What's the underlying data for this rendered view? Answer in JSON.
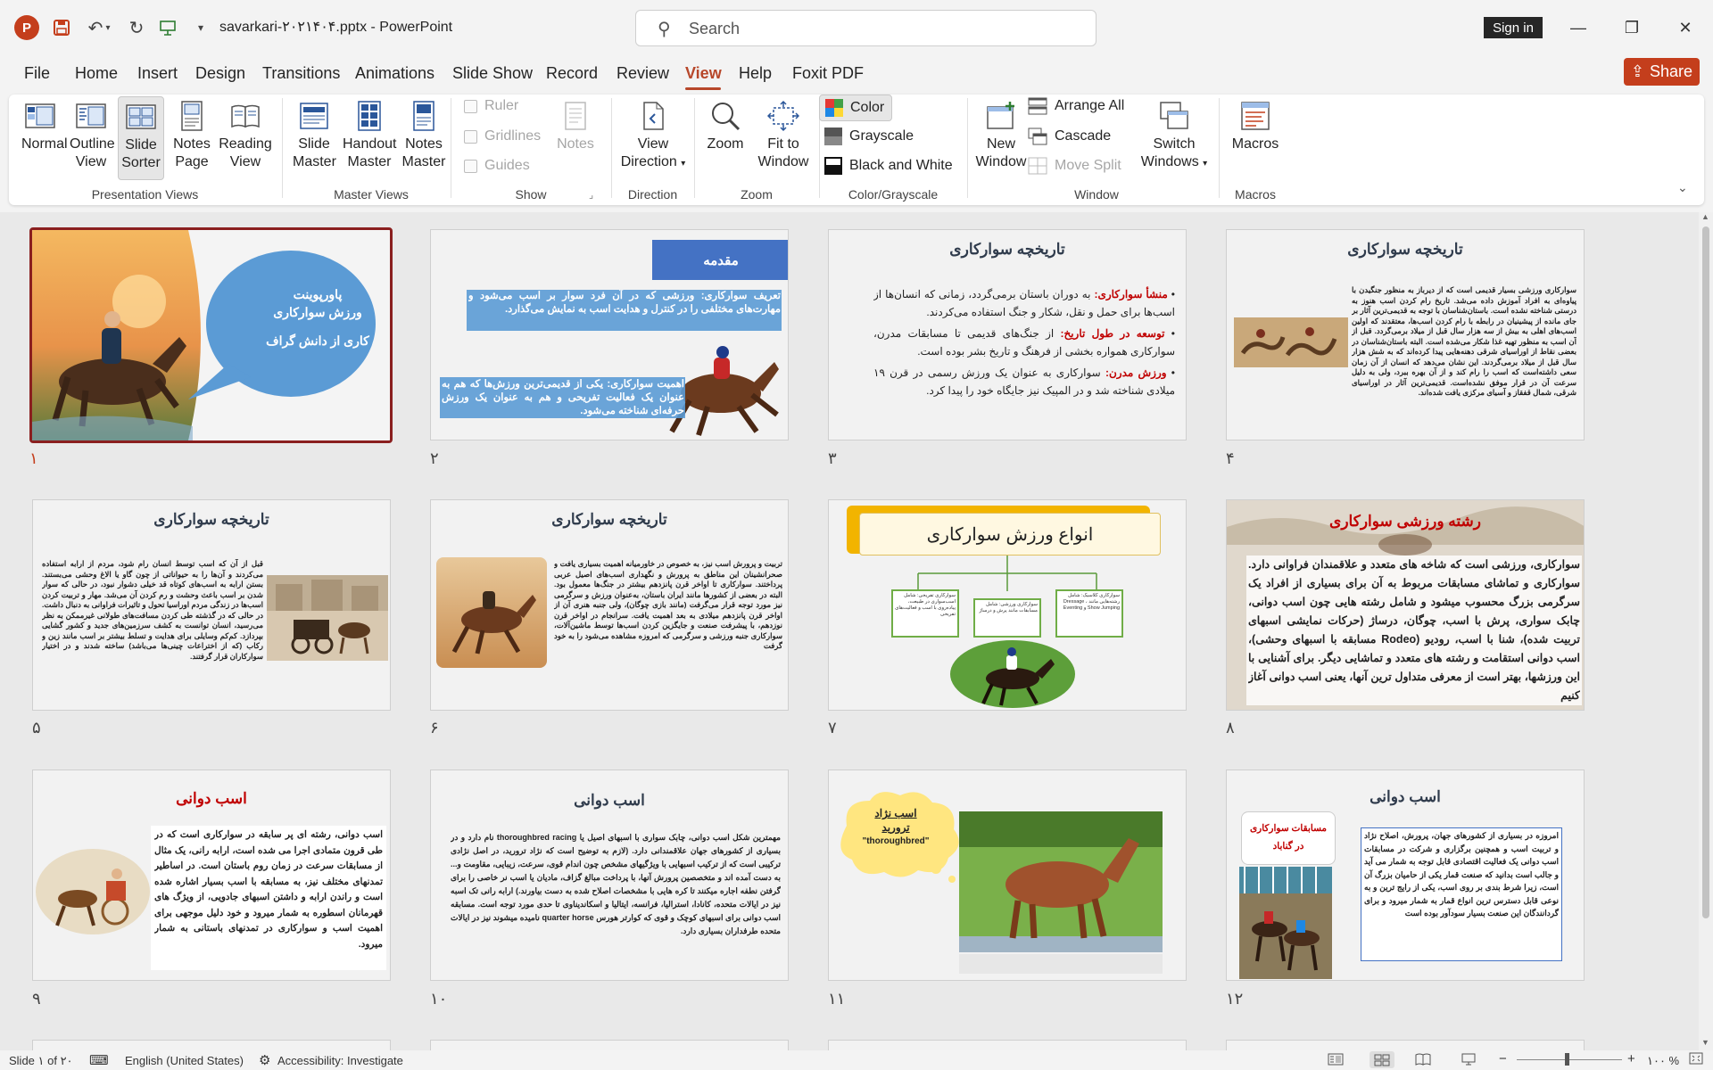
{
  "app": {
    "file_name": "savarkari-۲۰۲۱۴۰۴.pptx",
    "app_name": "PowerPoint",
    "title_sep": " - ",
    "search_placeholder": "Search",
    "sign_in": "Sign in",
    "share": "Share",
    "accent": "#c43e1c"
  },
  "tabs": [
    "File",
    "Home",
    "Insert",
    "Design",
    "Transitions",
    "Animations",
    "Slide Show",
    "Record",
    "Review",
    "View",
    "Help",
    "Foxit PDF"
  ],
  "active_tab": "View",
  "ribbon": {
    "presentation_views": {
      "label": "Presentation Views",
      "normal": "Normal",
      "outline_1": "Outline",
      "outline_2": "View",
      "sorter_1": "Slide",
      "sorter_2": "Sorter",
      "notes_1": "Notes",
      "notes_2": "Page",
      "reading_1": "Reading",
      "reading_2": "View"
    },
    "master_views": {
      "label": "Master Views",
      "slide_1": "Slide",
      "slide_2": "Master",
      "handout_1": "Handout",
      "handout_2": "Master",
      "notes_1": "Notes",
      "notes_2": "Master"
    },
    "show": {
      "label": "Show",
      "ruler": "Ruler",
      "gridlines": "Gridlines",
      "guides": "Guides",
      "notes": "Notes"
    },
    "direction": {
      "label": "Direction",
      "view_1": "View",
      "view_2": "Direction"
    },
    "zoom": {
      "label": "Zoom",
      "zoom": "Zoom",
      "fit_1": "Fit to",
      "fit_2": "Window"
    },
    "color": {
      "label": "Color/Grayscale",
      "color": "Color",
      "grayscale": "Grayscale",
      "bw": "Black and White"
    },
    "window": {
      "label": "Window",
      "new_1": "New",
      "new_2": "Window",
      "arrange": "Arrange All",
      "cascade": "Cascade",
      "move_split": "Move Split",
      "switch_1": "Switch",
      "switch_2": "Windows"
    },
    "macros": {
      "label": "Macros",
      "macros": "Macros"
    }
  },
  "slides": [
    {
      "num": "۱",
      "bubble_1": "پاورپوینت",
      "bubble_2": "ورزش سوارکاری",
      "bubble_3": "کاری از دانش گراف"
    },
    {
      "num": "۲",
      "header": "مقدمه",
      "para1": "تعریف سوارکاری: ورزشی که در آن فرد سوار بر اسب می‌شود و مهارت‌های مختلفی را در کنترل و هدایت اسب به نمایش می‌گذارد.",
      "para2": "اهمیت سوارکاری: یکی از قدیمی‌ترین ورزش‌ها که هم به عنوان یک فعالیت تفریحی و هم به عنوان یک ورزش حرفه‌ای شناخته می‌شود."
    },
    {
      "num": "۳",
      "title": "تاریخچه سوارکاری",
      "b1_head": "منشأ سوارکاری:",
      "b1": " به دوران باستان برمی‌گردد، زمانی که انسان‌ها از اسب‌ها برای حمل و نقل، شکار و جنگ استفاده می‌کردند.",
      "b2_head": "توسعه در طول تاریخ:",
      "b2": " از جنگ‌های قدیمی تا مسابقات مدرن، سوارکاری همواره بخشی از فرهنگ و تاریخ بشر بوده است.",
      "b3_head": "ورزش مدرن:",
      "b3": " سوارکاری به عنوان یک ورزش رسمی در قرن ۱۹ میلادی شناخته شد و در المپیک نیز جایگاه خود را پیدا کرد."
    },
    {
      "num": "۴",
      "title": "تاریخچه سوارکاری",
      "body": "سوارکاری ورزشی بسیار قدیمی است که از دیرباز به منظور جنگیدن با پیاوه‌ای به افراد آموزش داده می‌شد. تاریخ رام کردن اسب هنوز به درستی شناخته نشده است. باستان‌شناسان با توجه به قدیمی‌ترین آثار بر جای مانده از پیشینیان در رابطه با رام کردن اسب‌ها، معتقدند که اولین اسب‌های اهلی به بیش از سه هزار سال قبل از میلاد برمی‌گردد. قبل از آن اسب به منظور تهیه غذا شکار می‌شده است. البته باستان‌شناسان در بعضی نقاط از اوراسیای شرقی دهنه‌هایی پیدا کرده‌اند که به شش هزار سال قبل از میلاد برمی‌گردند. این نشان می‌دهد که انسان از آن زمان سعی داشته‌است که اسب را رام کند و از آن بهره ببرد، ولی به دلیل سرعت آن در قرار موفق نشده‌است. قدیمی‌ترین آثار در اوراسیای شرقی، شمال قفقاز و آسیای مرکزی یافت شده‌اند."
    },
    {
      "num": "۵",
      "title": "تاریخچه سوارکاری",
      "body": "قبل از آن که اسب توسط انسان رام شود، مردم از ارابه استفاده می‌کردند و آن‌ها را به حیواناتی از چون گاو یا الاغ وحشی می‌بستند. بستن ارابه به اسب‌های کوتاه قد خیلی دشوار نبود، در حالی که سوار شدن بر اسب باعث وحشت و رم کردن آن می‌شد. مهار و تربیت کردن اسب‌ها در زندگی مردم اوراسیا تحول و تاثیرات فراوانی به دنبال داشت. در حالی که در گذشته طی کردن مسافت‌های طولانی غیرممکن به نظر می‌رسید، انسان توانست به کشف سرزمین‌های جدید و کشور گشایی بپردازد. کم‌کم وسایلی برای هدایت و تسلط بیشتر بر اسب مانند زین و رکاب (که از اختراعات چینی‌ها می‌باشد) ساخته شدند و در اختیار سوارکاران قرار گرفتند."
    },
    {
      "num": "۶",
      "title": "تاریخچه سوارکاری",
      "body": "تربیت و پرورش اسب نیز، به خصوص در خاورمیانه اهمیت بسیاری یافت و صحرانشینان این مناطق به پرورش و نگهداری اسب‌های اصیل عربی پرداختند. سوارکاری تا اواخر قرن پانزدهم بیشتر در جنگ‌ها معمول بود. البته در بعضی از کشورها مانند ایران باستان، به‌عنوان ورزش و سرگرمی نیز مورد توجه قرار می‌گرفت (مانند بازی چوگان)، ولی جنبه هنری آن از اواخر قرن پانزدهم میلادی به بعد اهمیت یافت. سرانجام در اواخر قرن نوزدهم، با پیشرفت صنعت و جایگزین کردن اسب‌ها توسط ماشین‌آلات، سوارکاری جنبه ورزشی و سرگرمی که امروزه مشاهده می‌شود را به خود گرفت"
    },
    {
      "num": "۷",
      "title": "انواع ورزش سوارکاری",
      "box1": "سوارکاری تفریحی: شامل اسب‌سواری در طبیعت، پیاده‌روی با اسب و فعالیت‌های تفریحی",
      "box2": "سوارکاری ورزشی: شامل مسابقات مانند پرش و درساژ",
      "box3": "سوارکاری کلاسیک: شامل رشته‌هایی مانند Dressage ، Show Jumping و Eventing"
    },
    {
      "num": "۸",
      "title": "رشته ورزشی سوارکاری",
      "body": "سوارکاری، ورزشی است که شاخه های متعدد و علاقمندان فراوانی دارد. سوارکاری و تماشای مسابقات مربوط به آن برای بسیاری از افراد یک سرگرمی بزرگ محسوب میشود و شامل رشته هایی چون اسب دوانی، چابک سواری، پرش با اسب، چوگان، درساژ (حرکات نمایشی اسبهای تربیت شده)، شنا با اسب، رودیو (Rodeo مسابقه با اسبهای وحشی)، اسب دوانی استقامت و رشته های متعدد و تماشایی دیگر. برای آشنایی با این ورزشها، بهتر است از معرفی متداول ترین آنها، یعنی اسب دوانی آغاز کنیم"
    },
    {
      "num": "۹",
      "title": "اسب دوانی",
      "body": "اسب دوانی، رشته ای پر سابقه در سوارکاری است که در طی قرون متمادی اجرا می شده است، ارابه رانی، یک مثال از مسابقات سرعت در زمان روم باستان است. در اساطیر تمدنهای مختلف نیز، به مسابقه با اسب بسیار اشاره شده است و راندن ارابه و داشتن اسبهای جادویی، از ویژگ های قهرمانان اسطوره به شمار میرود و خود دلیل موجهی برای اهمیت اسب و سوارکاری در تمدنهای باستانی به شمار میرود."
    },
    {
      "num": "۱۰",
      "title": "اسب دوانی",
      "body": "مهمترین شکل اسب دوانی، چابک سواری با اسبهای اصیل یا thoroughbred racing نام دارد و در بسیاری از کشورهای جهان علاقمندانی دارد. (لازم به توضیح است که نژاد ترورید، در اصل نژادی ترکیبی است که از ترکیب اسبهایی با ویژگیهای مشخص چون اندام قوی، سرعت، زیبایی، مقاومت و... به دست آمده اند و متخصصین پرورش آنها، با پرداخت مبالغ گزاف، مادیان یا اسب نر خاصی را برای گرفتن نطفه اجاره میکنند تا کره هایی با مشخصات اصلاح شده به دست بیاورند.) ارابه رانی تک اسبه نیز در ایالات متحده، کانادا، استرالیا، فرانسه، ایتالیا و اسکاندیناوی تا حدی مورد توجه است. مسابقه اسب دوانی برای اسبهای کوچک و قوی که کوارتر هورس quarter horse نامیده میشوند نیز در ایالات متحده طرفداران بسیاری دارد."
    },
    {
      "num": "۱۱",
      "cloud_1": "اسب نژاد",
      "cloud_2": "ترورید",
      "cloud_3": "\"thoroughbred\""
    },
    {
      "num": "۱۲",
      "title": "اسب دوانی",
      "label_1": "مسابقات سوارکاری",
      "label_2": "در گناباد",
      "body": "امروزه در بسیاری از کشورهای جهان، پرورش، اصلاح نژاد و تربیت اسب و همچنین برگزاری و شرکت در مسابقات اسب دوانی یک فعالیت اقتصادی قابل توجه به شمار می آید و جالب است بدانید که صنعت قمار یکی از حامیان بزرگ آن است، زیرا شرط بندی بر روی اسب، یکی از رایج ترین و به نوعی قابل دسترس ترین انواع قمار به شمار میرود و برای گردانندگان این صنعت بسیار سودآور بوده است"
    }
  ],
  "status": {
    "slide_counter": "Slide ۱ of ۲۰",
    "language": "English (United States)",
    "accessibility": "Accessibility: Investigate",
    "zoom": "۱۰۰ %"
  }
}
